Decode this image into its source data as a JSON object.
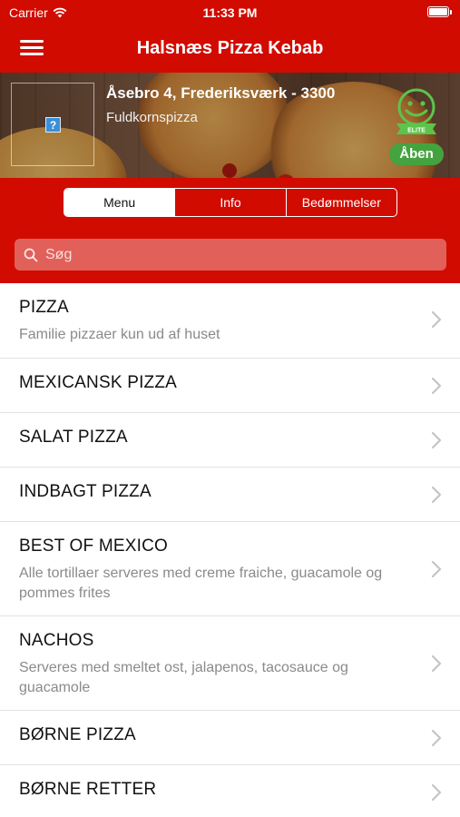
{
  "status_bar": {
    "carrier": "Carrier",
    "time": "11:33 PM"
  },
  "nav": {
    "title": "Halsnæs Pizza Kebab",
    "menu_icon": "hamburger-icon"
  },
  "header": {
    "address": "Åsebro 4, Frederiksværk - 3300",
    "subtitle": "Fuldkornspizza",
    "logo_placeholder": "?",
    "elite_badge_text": "ELITE",
    "open_status": "Åben"
  },
  "tabs": [
    {
      "label": "Menu",
      "active": true
    },
    {
      "label": "Info",
      "active": false
    },
    {
      "label": "Bedømmelser",
      "active": false
    }
  ],
  "search": {
    "placeholder": "Søg",
    "value": ""
  },
  "categories": [
    {
      "title": "PIZZA",
      "description": "Familie pizzaer kun ud af huset"
    },
    {
      "title": "MEXICANSK PIZZA",
      "description": ""
    },
    {
      "title": "SALAT PIZZA",
      "description": ""
    },
    {
      "title": "INDBAGT PIZZA",
      "description": ""
    },
    {
      "title": "BEST OF MEXICO",
      "description": "Alle tortillaer serveres med creme fraiche, guacamole og pommes frites"
    },
    {
      "title": "NACHOS",
      "description": "Serveres med smeltet ost, jalapenos, tacosauce og guacamole"
    },
    {
      "title": "BØRNE PIZZA",
      "description": ""
    },
    {
      "title": "BØRNE RETTER",
      "description": ""
    }
  ],
  "colors": {
    "brand_red": "#d10b00",
    "open_green": "#45a33f",
    "elite_green": "#5cc44c"
  }
}
